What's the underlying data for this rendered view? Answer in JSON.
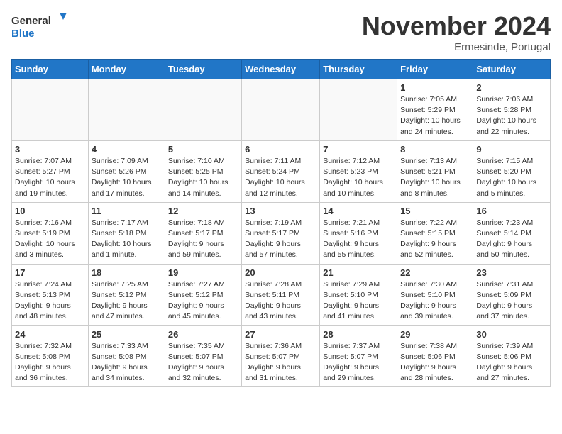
{
  "header": {
    "logo_general": "General",
    "logo_blue": "Blue",
    "month_title": "November 2024",
    "location": "Ermesinde, Portugal"
  },
  "weekdays": [
    "Sunday",
    "Monday",
    "Tuesday",
    "Wednesday",
    "Thursday",
    "Friday",
    "Saturday"
  ],
  "weeks": [
    [
      {
        "day": "",
        "info": ""
      },
      {
        "day": "",
        "info": ""
      },
      {
        "day": "",
        "info": ""
      },
      {
        "day": "",
        "info": ""
      },
      {
        "day": "",
        "info": ""
      },
      {
        "day": "1",
        "info": "Sunrise: 7:05 AM\nSunset: 5:29 PM\nDaylight: 10 hours\nand 24 minutes."
      },
      {
        "day": "2",
        "info": "Sunrise: 7:06 AM\nSunset: 5:28 PM\nDaylight: 10 hours\nand 22 minutes."
      }
    ],
    [
      {
        "day": "3",
        "info": "Sunrise: 7:07 AM\nSunset: 5:27 PM\nDaylight: 10 hours\nand 19 minutes."
      },
      {
        "day": "4",
        "info": "Sunrise: 7:09 AM\nSunset: 5:26 PM\nDaylight: 10 hours\nand 17 minutes."
      },
      {
        "day": "5",
        "info": "Sunrise: 7:10 AM\nSunset: 5:25 PM\nDaylight: 10 hours\nand 14 minutes."
      },
      {
        "day": "6",
        "info": "Sunrise: 7:11 AM\nSunset: 5:24 PM\nDaylight: 10 hours\nand 12 minutes."
      },
      {
        "day": "7",
        "info": "Sunrise: 7:12 AM\nSunset: 5:23 PM\nDaylight: 10 hours\nand 10 minutes."
      },
      {
        "day": "8",
        "info": "Sunrise: 7:13 AM\nSunset: 5:21 PM\nDaylight: 10 hours\nand 8 minutes."
      },
      {
        "day": "9",
        "info": "Sunrise: 7:15 AM\nSunset: 5:20 PM\nDaylight: 10 hours\nand 5 minutes."
      }
    ],
    [
      {
        "day": "10",
        "info": "Sunrise: 7:16 AM\nSunset: 5:19 PM\nDaylight: 10 hours\nand 3 minutes."
      },
      {
        "day": "11",
        "info": "Sunrise: 7:17 AM\nSunset: 5:18 PM\nDaylight: 10 hours\nand 1 minute."
      },
      {
        "day": "12",
        "info": "Sunrise: 7:18 AM\nSunset: 5:17 PM\nDaylight: 9 hours\nand 59 minutes."
      },
      {
        "day": "13",
        "info": "Sunrise: 7:19 AM\nSunset: 5:17 PM\nDaylight: 9 hours\nand 57 minutes."
      },
      {
        "day": "14",
        "info": "Sunrise: 7:21 AM\nSunset: 5:16 PM\nDaylight: 9 hours\nand 55 minutes."
      },
      {
        "day": "15",
        "info": "Sunrise: 7:22 AM\nSunset: 5:15 PM\nDaylight: 9 hours\nand 52 minutes."
      },
      {
        "day": "16",
        "info": "Sunrise: 7:23 AM\nSunset: 5:14 PM\nDaylight: 9 hours\nand 50 minutes."
      }
    ],
    [
      {
        "day": "17",
        "info": "Sunrise: 7:24 AM\nSunset: 5:13 PM\nDaylight: 9 hours\nand 48 minutes."
      },
      {
        "day": "18",
        "info": "Sunrise: 7:25 AM\nSunset: 5:12 PM\nDaylight: 9 hours\nand 47 minutes."
      },
      {
        "day": "19",
        "info": "Sunrise: 7:27 AM\nSunset: 5:12 PM\nDaylight: 9 hours\nand 45 minutes."
      },
      {
        "day": "20",
        "info": "Sunrise: 7:28 AM\nSunset: 5:11 PM\nDaylight: 9 hours\nand 43 minutes."
      },
      {
        "day": "21",
        "info": "Sunrise: 7:29 AM\nSunset: 5:10 PM\nDaylight: 9 hours\nand 41 minutes."
      },
      {
        "day": "22",
        "info": "Sunrise: 7:30 AM\nSunset: 5:10 PM\nDaylight: 9 hours\nand 39 minutes."
      },
      {
        "day": "23",
        "info": "Sunrise: 7:31 AM\nSunset: 5:09 PM\nDaylight: 9 hours\nand 37 minutes."
      }
    ],
    [
      {
        "day": "24",
        "info": "Sunrise: 7:32 AM\nSunset: 5:08 PM\nDaylight: 9 hours\nand 36 minutes."
      },
      {
        "day": "25",
        "info": "Sunrise: 7:33 AM\nSunset: 5:08 PM\nDaylight: 9 hours\nand 34 minutes."
      },
      {
        "day": "26",
        "info": "Sunrise: 7:35 AM\nSunset: 5:07 PM\nDaylight: 9 hours\nand 32 minutes."
      },
      {
        "day": "27",
        "info": "Sunrise: 7:36 AM\nSunset: 5:07 PM\nDaylight: 9 hours\nand 31 minutes."
      },
      {
        "day": "28",
        "info": "Sunrise: 7:37 AM\nSunset: 5:07 PM\nDaylight: 9 hours\nand 29 minutes."
      },
      {
        "day": "29",
        "info": "Sunrise: 7:38 AM\nSunset: 5:06 PM\nDaylight: 9 hours\nand 28 minutes."
      },
      {
        "day": "30",
        "info": "Sunrise: 7:39 AM\nSunset: 5:06 PM\nDaylight: 9 hours\nand 27 minutes."
      }
    ]
  ]
}
